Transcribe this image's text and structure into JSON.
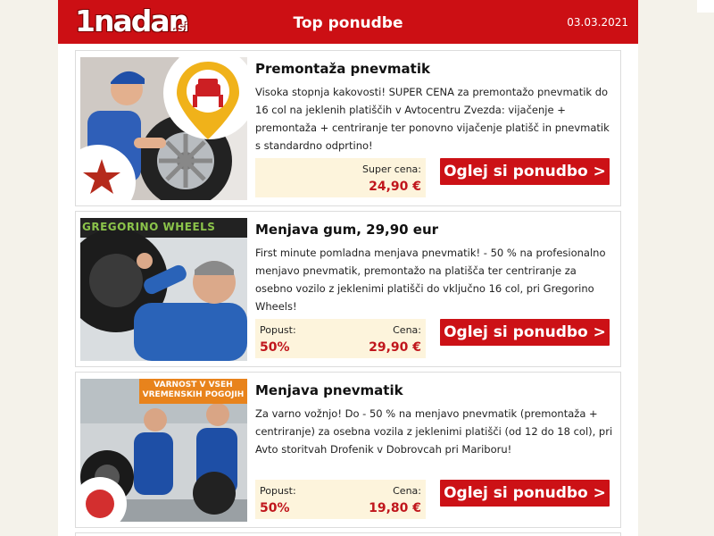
{
  "header": {
    "logo": "1nadan",
    "logo_tld": ".si",
    "title": "Top ponudbe",
    "date": "03.03.2021"
  },
  "offers": [
    {
      "title": "Premontaža pnevmatik",
      "description": "Visoka stopnja kakovosti! SUPER CENA za premontažo pnevmatik do 16 col na jeklenih platiščih v Avtocentru Zvezda: vijačenje + premontaža + centriranje ter ponovno vijačenje platišč in pnevmatik s standardno odprtino!",
      "left_label": "",
      "left_value": "",
      "right_label": "Super cena:",
      "right_value": "24,90 €",
      "cta": "Oglej si ponudbo >",
      "image_badge": "ZVEZDA"
    },
    {
      "title": "Menjava gum, 29,90 eur",
      "description": "First minute pomladna menjava pnevmatik! - 50 % na profesionalno menjavo pnevmatik, premontažo na platišča ter centriranje za osebno vozilo z jeklenimi platišči do vključno 16 col, pri Gregorino Wheels!",
      "left_label": "Popust:",
      "left_value": "50%",
      "right_label": "Cena:",
      "right_value": "29,90 €",
      "cta": "Oglej si ponudbo >",
      "image_banner": "GREGORINO WHEELS"
    },
    {
      "title": "Menjava pnevmatik",
      "description": "Za varno vožnjo! Do - 50 % na menjavo pnevmatik (premontaža + centriranje) za osebna vozila z jeklenimi platišči (od 12 do 18 col), pri Avto storitvah Drofenik v Dobrovcah pri Mariboru!",
      "left_label": "Popust:",
      "left_value": "50%",
      "right_label": "Cena:",
      "right_value": "19,80 €",
      "cta": "Oglej si ponudbo >",
      "image_banner": "VARNOST V VSEH VREMENSKIH POGOJIH"
    }
  ],
  "colors": {
    "brand_red": "#cc0f14",
    "price_red": "#c0161c",
    "price_bg": "#fdf4dc",
    "page_bg": "#f4f2ea"
  }
}
